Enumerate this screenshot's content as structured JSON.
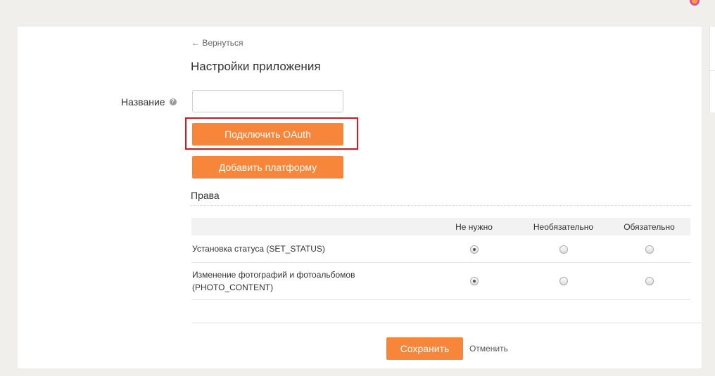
{
  "nav": {
    "back_label": "← Вернуться"
  },
  "page": {
    "title": "Настройки приложения"
  },
  "form": {
    "name_label": "Название",
    "name_value": "",
    "help_icon": "question-circle-icon"
  },
  "buttons": {
    "oauth_label": "Подключить OAuth",
    "add_platform_label": "Добавить платформу",
    "save_label": "Сохранить",
    "cancel_label": "Отменить"
  },
  "rights": {
    "section_title": "Права",
    "columns": [
      "",
      "Не нужно",
      "Необязательно",
      "Обязательно"
    ],
    "rows": [
      {
        "label": "Установка статуса (SET_STATUS)",
        "selected": "Не нужно"
      },
      {
        "label_line1": "Изменение фотографий и фотоальбомов",
        "label_line2": "(PHOTO_CONTENT)",
        "selected": "Не нужно"
      }
    ]
  },
  "colors": {
    "accent": "#f7853a",
    "highlight": "#e0141e",
    "background": "#f0efec"
  }
}
